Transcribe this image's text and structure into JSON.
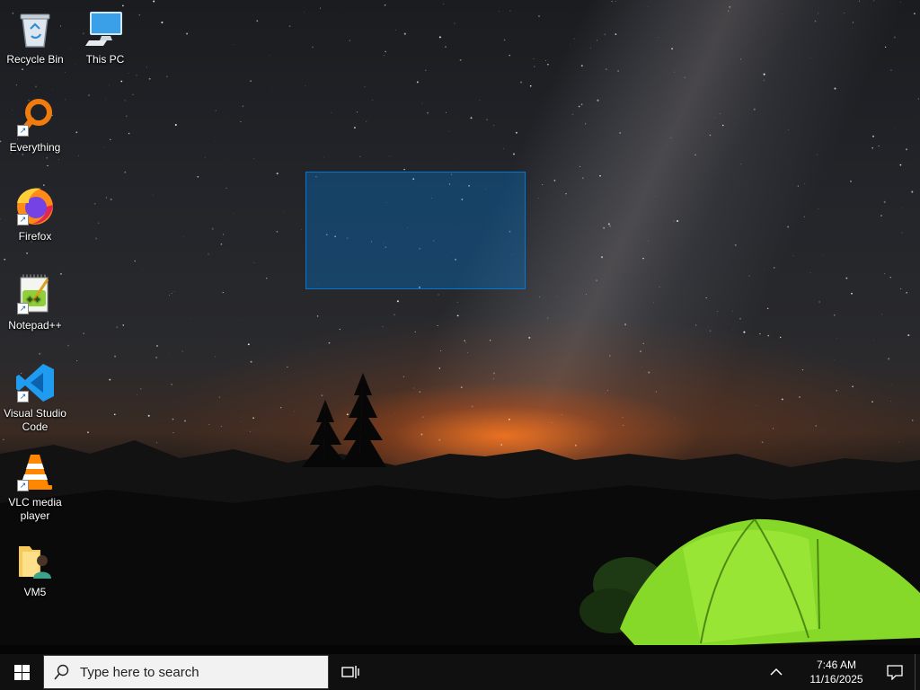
{
  "desktop": {
    "icons": [
      {
        "label": "Recycle Bin",
        "icon": "recycle-bin-icon"
      },
      {
        "label": "This PC",
        "icon": "computer-monitor-icon"
      },
      {
        "label": "Everything",
        "icon": "everything-search-icon"
      },
      {
        "label": "Firefox",
        "icon": "firefox-icon"
      },
      {
        "label": "Notepad++",
        "icon": "notepad-plus-plus-icon"
      },
      {
        "label": "Visual Studio Code",
        "icon": "vscode-icon"
      },
      {
        "label": "VLC media player",
        "icon": "vlc-cone-icon"
      },
      {
        "label": "VM5",
        "icon": "user-folder-icon"
      }
    ]
  },
  "taskbar": {
    "search_placeholder": "Type here to search",
    "time": "7:46 AM",
    "date": "11/16/2025"
  },
  "colors": {
    "accent": "#0078d7",
    "taskbar_bg": "#101010",
    "tent_green": "#8ee02a"
  }
}
